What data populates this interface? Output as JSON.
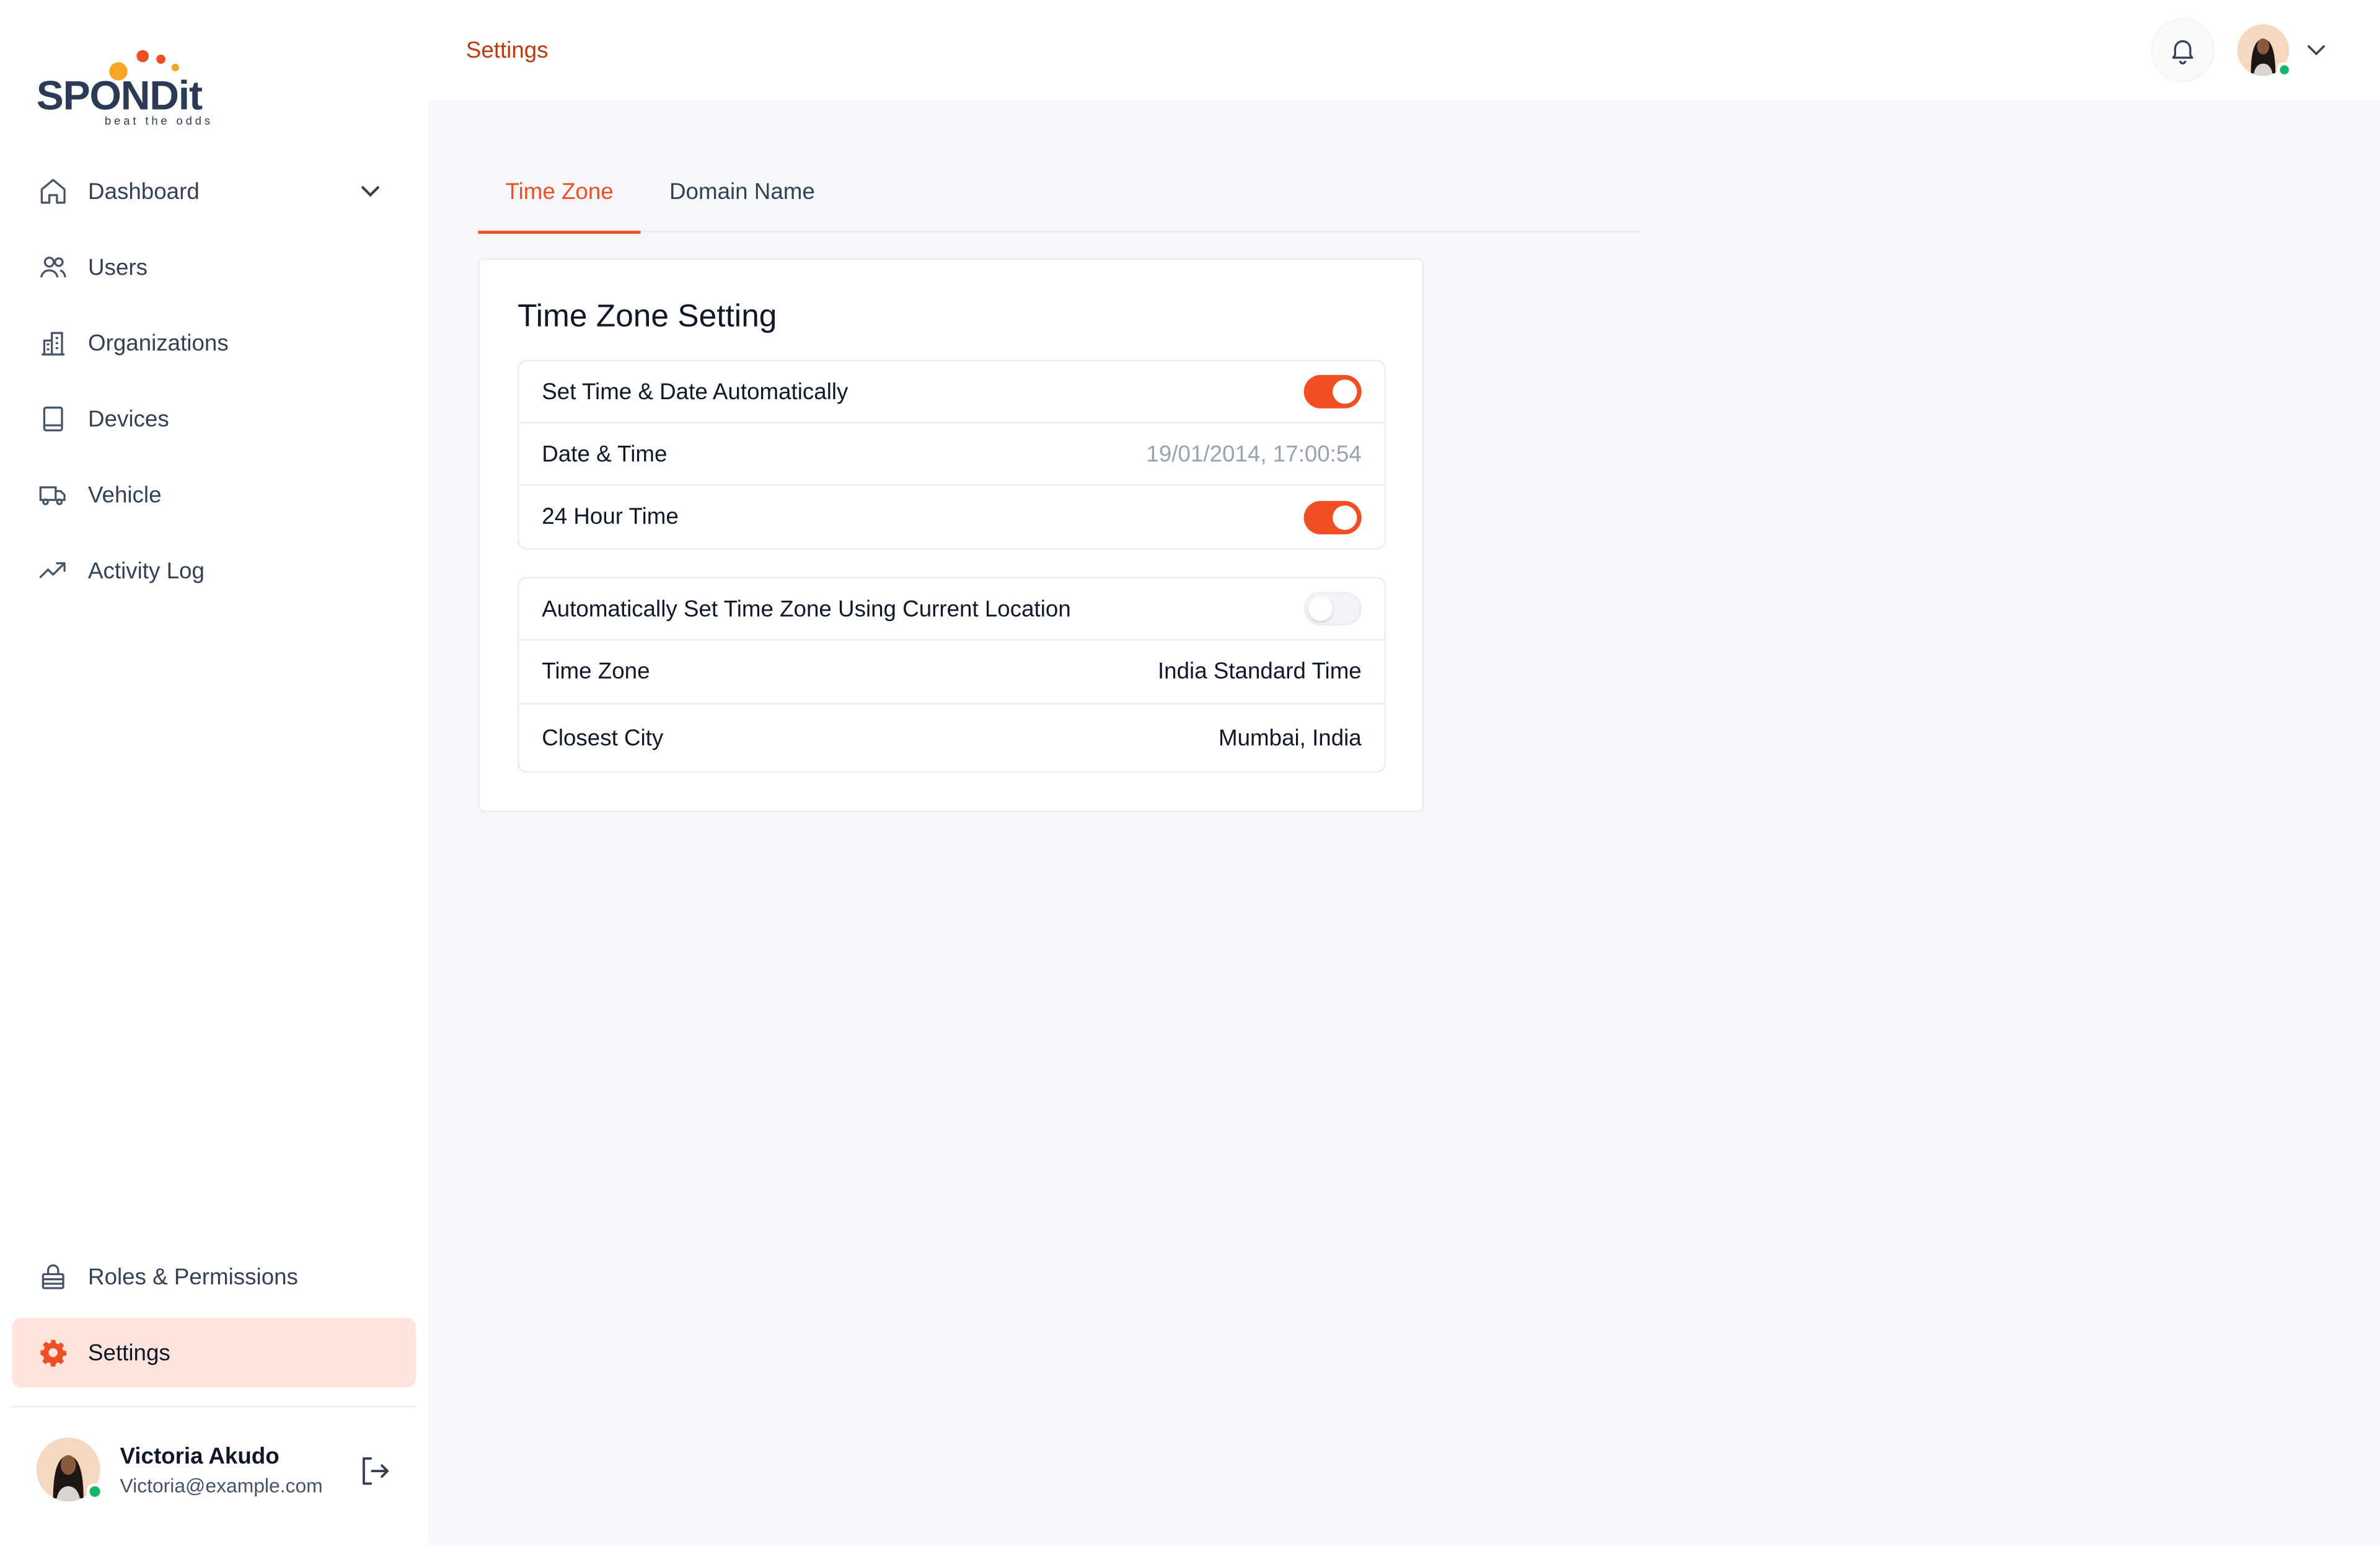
{
  "brand": {
    "wordmark": "SPONDit",
    "tagline": "beat the odds",
    "colors": {
      "accent": "#f04e23",
      "active_bg": "#fee4dc",
      "navy": "#2b3a55"
    }
  },
  "sidebar": {
    "items": [
      {
        "label": "Dashboard",
        "icon": "home-icon",
        "has_chevron": true
      },
      {
        "label": "Users",
        "icon": "users-icon"
      },
      {
        "label": "Organizations",
        "icon": "building-icon"
      },
      {
        "label": "Devices",
        "icon": "tablet-icon"
      },
      {
        "label": "Vehicle",
        "icon": "truck-icon"
      },
      {
        "label": "Activity Log",
        "icon": "trend-icon"
      }
    ],
    "bottom_items": [
      {
        "label": "Roles & Permissions",
        "icon": "lock-icon"
      },
      {
        "label": "Settings",
        "icon": "gear-icon",
        "active": true
      }
    ],
    "user": {
      "name": "Victoria Akudo",
      "email": "Victoria@example.com"
    }
  },
  "header": {
    "breadcrumb": "Settings"
  },
  "tabs": [
    {
      "label": "Time Zone",
      "active": true
    },
    {
      "label": "Domain Name",
      "active": false
    }
  ],
  "card": {
    "title": "Time Zone Setting",
    "group1": [
      {
        "label": "Set Time & Date Automatically",
        "toggle": true
      },
      {
        "label": "Date & Time",
        "value": "19/01/2014, 17:00:54"
      },
      {
        "label": "24 Hour Time",
        "toggle": true
      }
    ],
    "group2": [
      {
        "label": "Automatically Set Time Zone Using Current Location",
        "toggle": false
      },
      {
        "label": "Time Zone",
        "value": "India Standard Time"
      },
      {
        "label": "Closest City",
        "value": "Mumbai, India"
      }
    ]
  }
}
